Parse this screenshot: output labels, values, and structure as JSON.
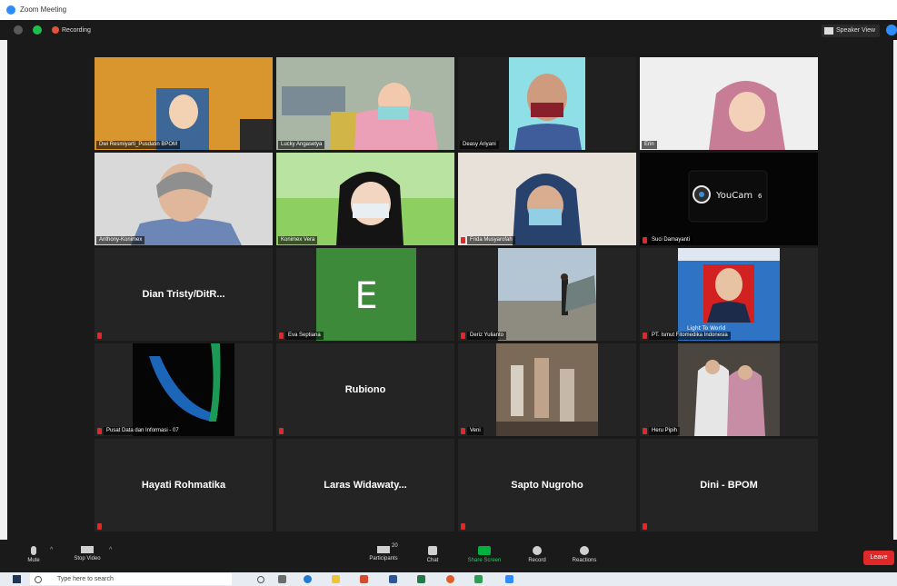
{
  "window": {
    "title": "Zoom Meeting"
  },
  "topbar": {
    "recording_label": "Recording",
    "speaker_view_label": "Speaker View"
  },
  "participants": [
    {
      "name": "Dwi Resmiyarti_Pusdatin BPOM",
      "muted": false,
      "video": true,
      "active": false
    },
    {
      "name": "Lucky Angasetya",
      "muted": false,
      "video": true,
      "active": true
    },
    {
      "name": "Deasy Ariyani",
      "muted": false,
      "video": true,
      "active": false
    },
    {
      "name": "Erin",
      "muted": false,
      "video": true,
      "active": false
    },
    {
      "name": "Anthony-Konimex",
      "muted": false,
      "video": true,
      "active": false
    },
    {
      "name": "Konimex Vera",
      "muted": false,
      "video": true,
      "active": false
    },
    {
      "name": "Frida Musyarofah",
      "muted": true,
      "video": true,
      "active": false
    },
    {
      "name": "Suci Damayanti",
      "muted": true,
      "video": true,
      "active": false
    },
    {
      "name": "Dian Tristy/DitR...",
      "muted": true,
      "video": false,
      "active": false
    },
    {
      "name": "Eva Septiana",
      "muted": true,
      "video": true,
      "active": false
    },
    {
      "name": "Deriz Yulianto",
      "muted": true,
      "video": true,
      "active": false
    },
    {
      "name": "PT. Ismut Fitomedika Indonesia",
      "muted": true,
      "video": true,
      "active": false
    },
    {
      "name": "Pusat Data dan Informasi - 07",
      "muted": true,
      "video": true,
      "active": false
    },
    {
      "name": "Rubiono",
      "muted": true,
      "video": false,
      "active": false
    },
    {
      "name": "Veni",
      "muted": true,
      "video": true,
      "active": false
    },
    {
      "name": "Heru Pipih",
      "muted": true,
      "video": true,
      "active": false
    },
    {
      "name": "Hayati Rohmatika",
      "muted": true,
      "video": false,
      "active": false
    },
    {
      "name": "Laras Widawaty...",
      "muted": false,
      "video": false,
      "active": false
    },
    {
      "name": "Sapto Nugroho",
      "muted": true,
      "video": false,
      "active": false
    },
    {
      "name": "Dini - BPOM",
      "muted": true,
      "video": false,
      "active": false
    }
  ],
  "tile_art": {
    "avatar_letter": "E",
    "youcam_label": "YouCam",
    "youcam_version": "6",
    "banner_caption": "Light To World"
  },
  "toolbar": {
    "mute_label": "Mute",
    "stop_video_label": "Stop Video",
    "participants_label": "Participants",
    "participants_count": "20",
    "chat_label": "Chat",
    "share_screen_label": "Share Screen",
    "record_label": "Record",
    "reactions_label": "Reactions",
    "leave_label": "Leave"
  },
  "taskbar": {
    "search_placeholder": "Type here to search"
  },
  "colors": {
    "accent_blue": "#2d8cff",
    "share_green": "#00b140",
    "leave_red": "#e02828",
    "active_outline": "#c8d400"
  }
}
